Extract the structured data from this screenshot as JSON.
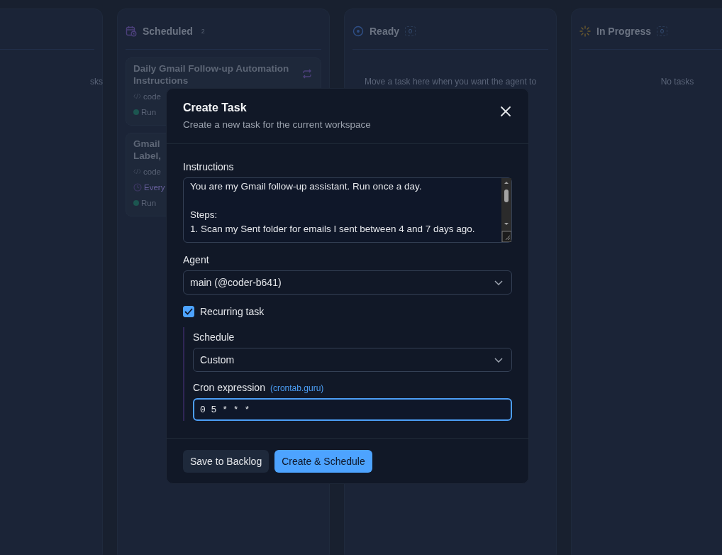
{
  "board": {
    "columns": [
      {
        "empty_text": "sks"
      },
      {
        "title": "Scheduled",
        "count": "2",
        "cards": [
          {
            "title_lines": [
              "Daily Gmail Follow-up Automation",
              "Instructions"
            ],
            "recurring": true,
            "meta": [
              {
                "kind": "code",
                "text": "code"
              },
              {
                "kind": "run",
                "text": "Run"
              }
            ]
          },
          {
            "title_lines": [
              "Gmail",
              "Label,"
            ],
            "recurring": false,
            "meta": [
              {
                "kind": "code",
                "text": "code"
              },
              {
                "kind": "schedule",
                "text": "Every"
              },
              {
                "kind": "run",
                "text": "Run"
              }
            ]
          }
        ]
      },
      {
        "title": "Ready",
        "count": "0",
        "empty_text": "Move a task here when you want the agent to"
      },
      {
        "title": "In Progress",
        "count": "0",
        "empty_text": "No tasks"
      }
    ]
  },
  "dialog": {
    "title": "Create Task",
    "subtitle": "Create a new task for the current workspace",
    "instructions": {
      "label": "Instructions",
      "value": "You are my Gmail follow-up assistant. Run once a day.\n\nSteps:\n1. Scan my Sent folder for emails I sent between 4 and 7 days ago."
    },
    "agent": {
      "label": "Agent",
      "value": "main (@coder-b641)"
    },
    "recurring": {
      "label": "Recurring task",
      "checked": true
    },
    "schedule": {
      "label": "Schedule",
      "value": "Custom"
    },
    "cron": {
      "label": "Cron expression",
      "link": "(crontab.guru)",
      "value": "0 5 * * *",
      "focused": true
    },
    "buttons": [
      {
        "label": "Save to Backlog",
        "primary": false
      },
      {
        "label": "Create & Schedule",
        "primary": true
      }
    ]
  }
}
